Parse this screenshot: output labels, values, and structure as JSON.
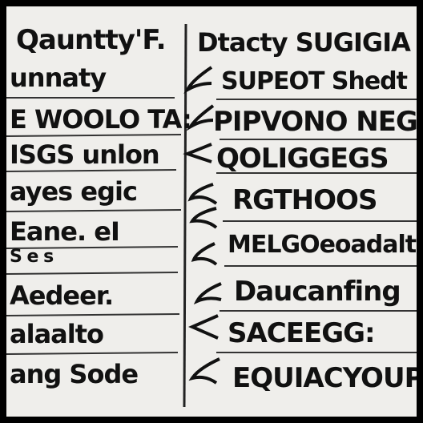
{
  "header": {
    "left": "Qauntty'F.",
    "right": "Dtacty SUGIGIA"
  },
  "rows_left": [
    "unnaty",
    "E WOOLO TA:",
    "ISGS unlon",
    "ayes egic",
    "Eane. eI",
    "S   e   s",
    "Aedeer.",
    "alaalto",
    "ang Sode"
  ],
  "rows_right": [
    "SUPEOT Shedt",
    "PIPVONO NEGE",
    "QOLIGGEGS",
    "RGTHOOS",
    "MELGOeoadalt",
    "Daucanfing",
    "SACEEGG:",
    "EQUIACYOUP"
  ]
}
